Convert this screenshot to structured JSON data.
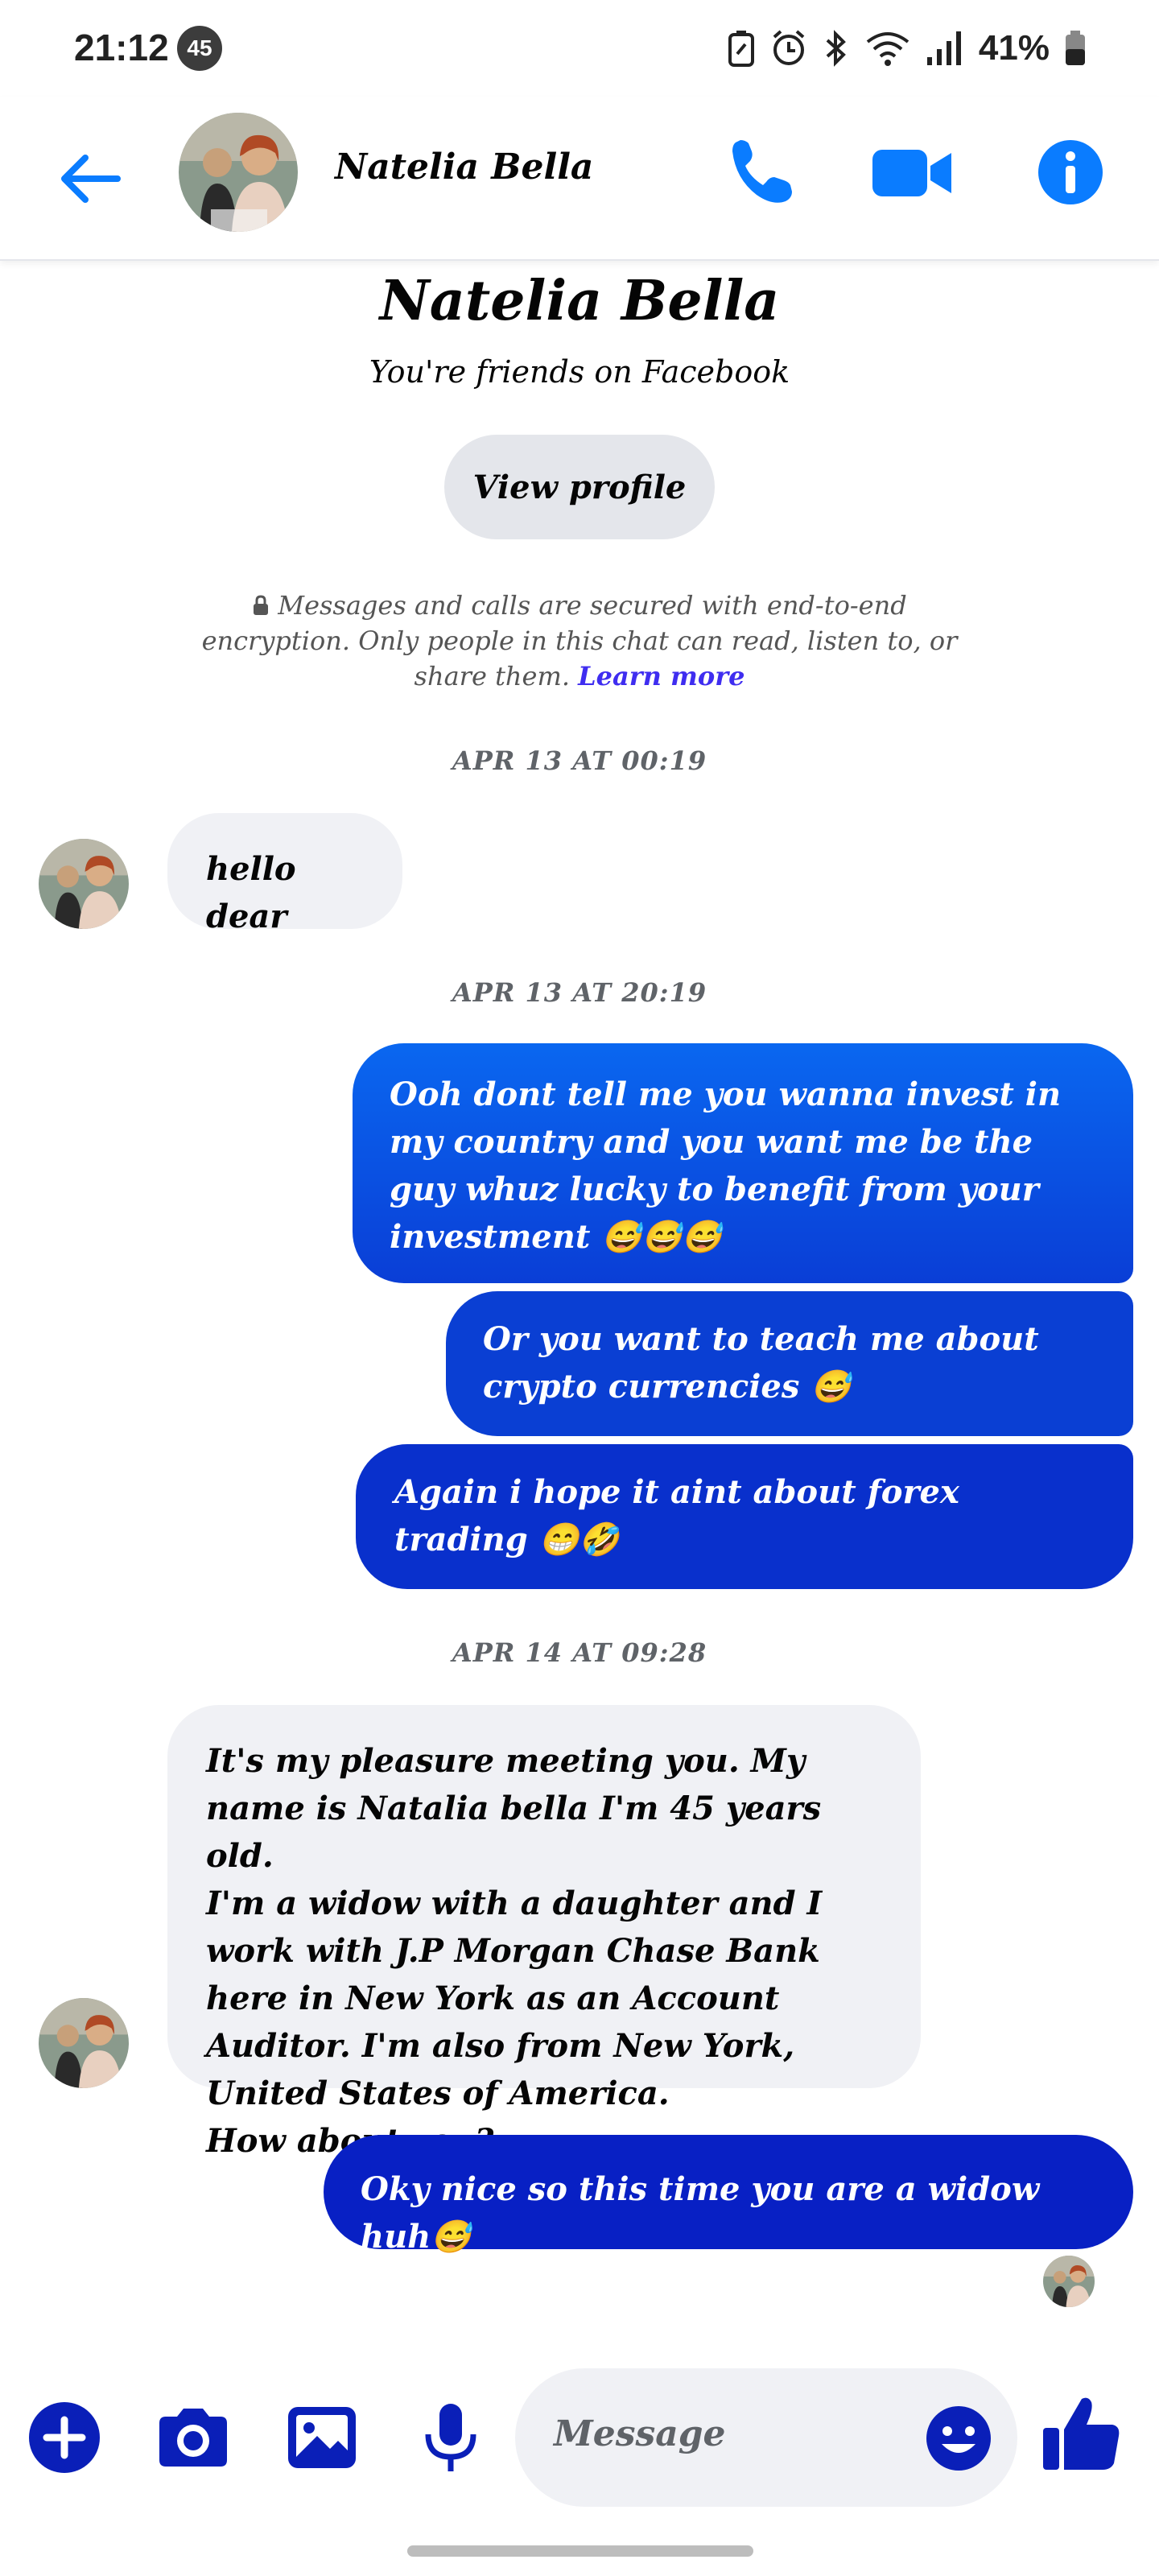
{
  "status_bar": {
    "time": "21:12",
    "notification_count": "45",
    "battery": "41%"
  },
  "header": {
    "back_icon": "arrow-left-icon",
    "contact_name": "Natelia Bella",
    "call_icon": "phone-icon",
    "video_icon": "video-camera-icon",
    "info_icon": "info-icon"
  },
  "intro": {
    "name": "Natelia Bella",
    "subtitle": "You're friends on Facebook",
    "view_profile_label": "View profile",
    "encryption_text": "Messages and calls are secured with end-to-end encryption. Only people in this chat can read, listen to, or share them.",
    "learn_more": "Learn more"
  },
  "messages": [
    {
      "timestamp": "APR 13 AT 00:19"
    },
    {
      "direction": "incoming",
      "text": "hello dear"
    },
    {
      "timestamp": "APR 13 AT 20:19"
    },
    {
      "direction": "outgoing",
      "text": "Ooh dont tell me you wanna invest in my country and you want me be the guy whuz lucky to benefit from your investment 😅😅😅"
    },
    {
      "direction": "outgoing",
      "text": "Or you want to teach me about crypto currencies 😅"
    },
    {
      "direction": "outgoing",
      "text": "Again i hope it aint about forex trading 😁🤣"
    },
    {
      "timestamp": "APR 14 AT 09:28"
    },
    {
      "direction": "incoming",
      "text": "It's my pleasure meeting you. My name is Natalia bella I'm 45 years old.\nI'm a widow with a daughter and I work with J.P Morgan Chase Bank here in New York as an Account Auditor. I'm also from New York, United States of America.\nHow about you?"
    },
    {
      "direction": "outgoing",
      "text": "Oky nice so this time you are a widow huh😅"
    }
  ],
  "composer": {
    "placeholder": "Message",
    "icons": [
      "plus-icon",
      "camera-icon",
      "image-icon",
      "microphone-icon",
      "emoji-icon",
      "thumbs-up-icon"
    ]
  },
  "colors": {
    "accent": "#0a7cff",
    "bubble_out_top": "#0a67f0",
    "bubble_out_bottom": "#0820c4",
    "bubble_in": "#f0f1f5",
    "composer_icons": "#0a1fb8"
  }
}
